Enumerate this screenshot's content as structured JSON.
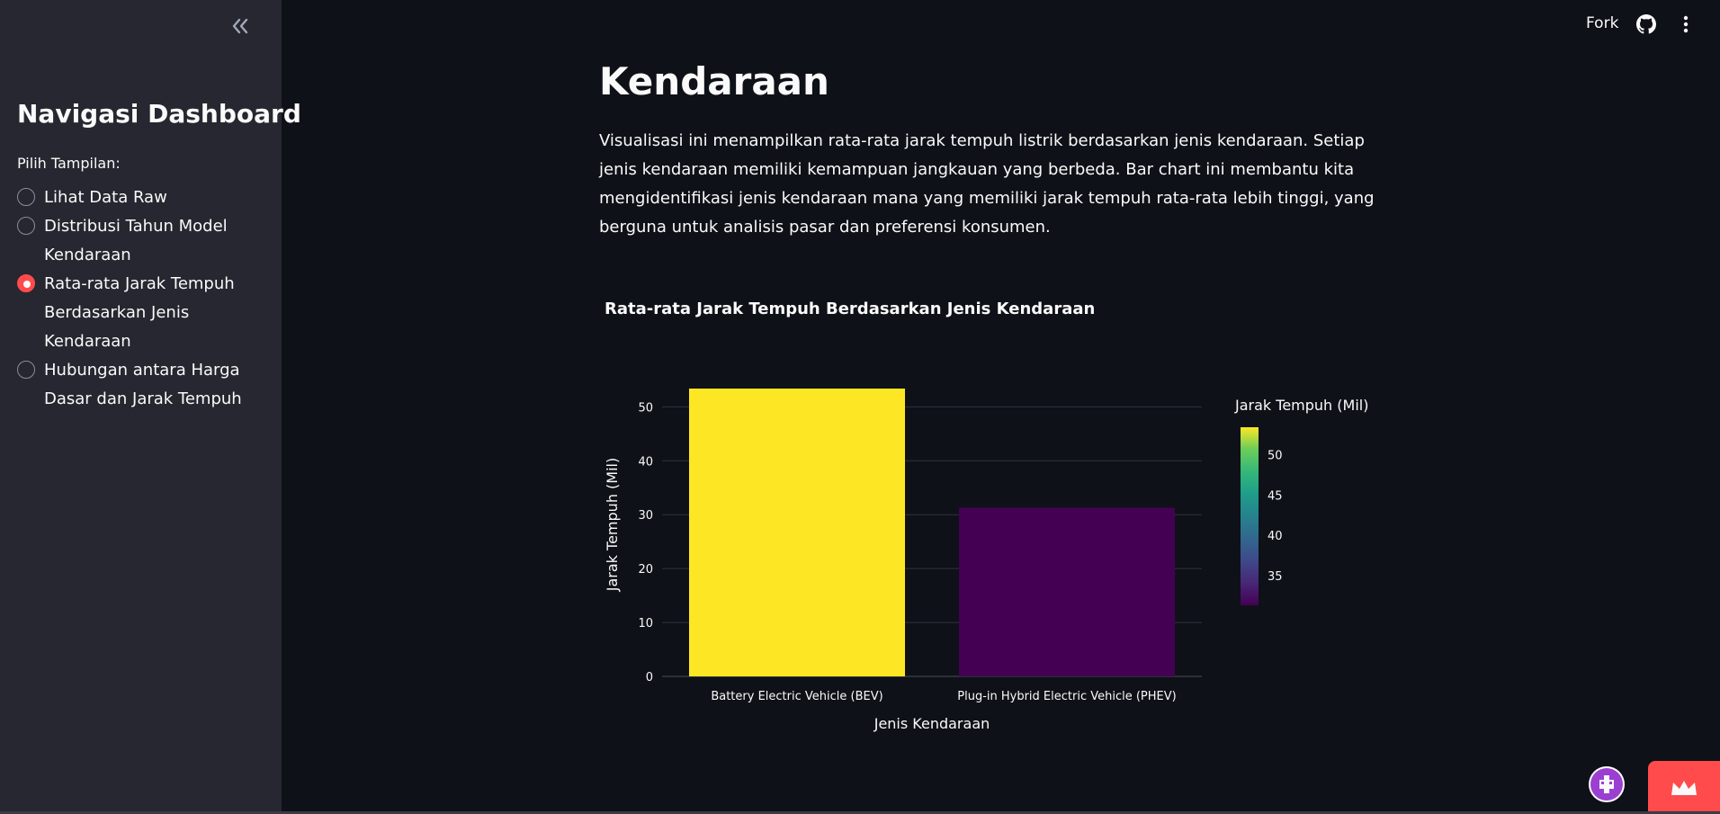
{
  "sidebar": {
    "title": "Navigasi Dashboard",
    "radio_label": "Pilih Tampilan:",
    "options": [
      {
        "label": "Lihat Data Raw",
        "selected": false
      },
      {
        "label": "Distribusi Tahun Model Kendaraan",
        "selected": false
      },
      {
        "label": "Rata-rata Jarak Tempuh Berdasarkan Jenis Kendaraan",
        "selected": true
      },
      {
        "label": "Hubungan antara Harga Dasar dan Jarak Tempuh",
        "selected": false
      }
    ]
  },
  "header": {
    "fork_label": "Fork"
  },
  "main": {
    "title": "Kendaraan",
    "description": "Visualisasi ini menampilkan rata-rata jarak tempuh listrik berdasarkan jenis kendaraan. Setiap jenis kendaraan memiliki kemampuan jangkauan yang berbeda. Bar chart ini membantu kita mengidentifikasi jenis kendaraan mana yang memiliki jarak tempuh rata-rata lebih tinggi, yang berguna untuk analisis pasar dan preferensi konsumen."
  },
  "colors": {
    "accent": "#ff4b4b",
    "background": "#0e1117",
    "sidebar": "#262730"
  },
  "chart_data": {
    "type": "bar",
    "title": "Rata-rata Jarak Tempuh Berdasarkan Jenis Kendaraan",
    "xlabel": "Jenis Kendaraan",
    "ylabel": "Jarak Tempuh (Mil)",
    "categories": [
      "Battery Electric Vehicle (BEV)",
      "Plug-in Hybrid Electric Vehicle (PHEV)"
    ],
    "values": [
      53.4,
      31.3
    ],
    "ylim": [
      0,
      53.4
    ],
    "yticks": [
      0,
      10,
      20,
      30,
      40,
      50
    ],
    "grid": true,
    "colorscale": "viridis",
    "colorbar": {
      "title": "Jarak Tempuh (Mil)",
      "ticks": [
        35,
        40,
        45,
        50
      ],
      "range": [
        31.3,
        53.4
      ]
    }
  }
}
